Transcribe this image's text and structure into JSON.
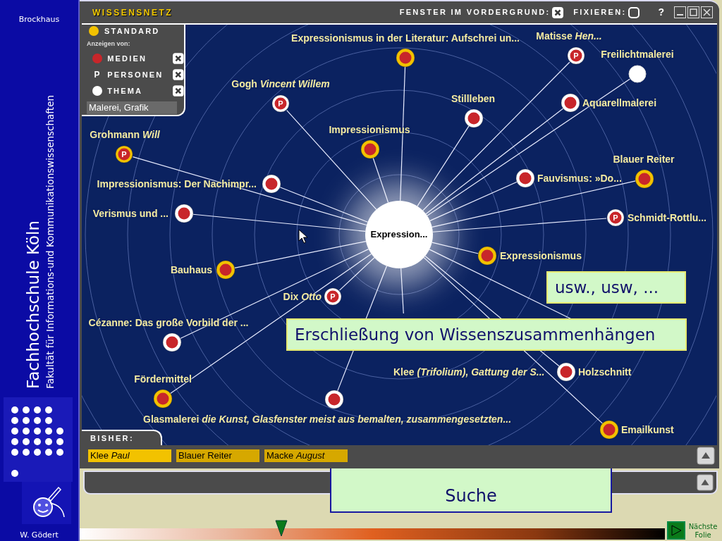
{
  "sidebar": {
    "top_label": "Brockhaus",
    "title": "Fachhochschule Köln",
    "subtitle": "Fakultät für Informations-und Kommunikationswissenschaften",
    "author": "W. Gödert"
  },
  "window": {
    "title": "WISSENSNETZ",
    "options": [
      {
        "label": "FENSTER IM VORDERGRUND:",
        "checked": true
      },
      {
        "label": "FIXIEREN:",
        "checked": false
      }
    ],
    "help": "?"
  },
  "legend": {
    "standard": "STANDARD",
    "heading": "Anzeigen von:",
    "filters": [
      {
        "kind": "medien",
        "label": "MEDIEN",
        "checked": true
      },
      {
        "kind": "person",
        "symbol": "P",
        "label": "PERSONEN",
        "checked": true
      },
      {
        "kind": "thema",
        "label": "THEMA",
        "checked": true
      }
    ],
    "search_value": "Malerei, Grafik"
  },
  "network": {
    "center": "Expression...",
    "nodes": [
      {
        "label": "Expressionismus in der Literatur: Aufschrei un...",
        "kind": "medien",
        "standard": true
      },
      {
        "label": "Matisse *Hen...*",
        "kind": "person",
        "symbol": "P",
        "standard": false
      },
      {
        "label": "Freilichtmalerei",
        "kind": "thema",
        "standard": false
      },
      {
        "label": "Gogh *Vincent Willem*",
        "kind": "person",
        "symbol": "P",
        "standard": false
      },
      {
        "label": "Stillleben",
        "kind": "medien",
        "standard": false
      },
      {
        "label": "Aquarellmalerei",
        "kind": "medien",
        "standard": false
      },
      {
        "label": "Grohmann *Will*",
        "kind": "person",
        "symbol": "P",
        "standard": true
      },
      {
        "label": "Impressionismus",
        "kind": "medien",
        "standard": true
      },
      {
        "label": "Blauer Reiter",
        "kind": "medien",
        "standard": true
      },
      {
        "label": "Impressionismus: Der Nachimpr...",
        "kind": "medien",
        "standard": false
      },
      {
        "label": "Fauvismus: »Do...",
        "kind": "medien",
        "standard": false
      },
      {
        "label": "Verismus und ...",
        "kind": "medien",
        "standard": false
      },
      {
        "label": "Schmidt-Rottlu...",
        "kind": "person",
        "symbol": "P",
        "standard": false
      },
      {
        "label": "Expressionismus",
        "kind": "medien",
        "standard": true
      },
      {
        "label": "Bauhaus",
        "kind": "medien",
        "standard": true
      },
      {
        "label": "Dix *Otto*",
        "kind": "person",
        "symbol": "P",
        "standard": false
      },
      {
        "label": "Cézanne: Das große Vorbild der ...",
        "kind": "medien",
        "standard": false
      },
      {
        "label": "Klee *(Trifolium), Gattung der S...*"
      },
      {
        "label": "Holzschnitt",
        "kind": "medien",
        "standard": false
      },
      {
        "label": "Fördermittel",
        "kind": "medien",
        "standard": true
      },
      {
        "label": "Glasmalerei *die Kunst, Glasfenster meist aus bemalten, zusammengesetzten...*",
        "kind": "medien",
        "standard": false
      },
      {
        "label": "Emailkunst",
        "kind": "medien",
        "standard": true
      }
    ]
  },
  "callouts": [
    {
      "text": "usw., usw, ..."
    },
    {
      "text": "Erschließung von Wissenszusammenhängen"
    }
  ],
  "history": {
    "label": "BISHER:",
    "items": [
      {
        "label": "Klee *Paul*",
        "selected": true
      },
      {
        "label": "Blauer Reiter",
        "selected": false
      },
      {
        "label": "Macke *August*",
        "selected": false
      }
    ]
  },
  "callout_behind": {
    "text": "Suche"
  },
  "progress": {
    "level": 0.345
  },
  "next": {
    "label": "Nächste Folie"
  }
}
